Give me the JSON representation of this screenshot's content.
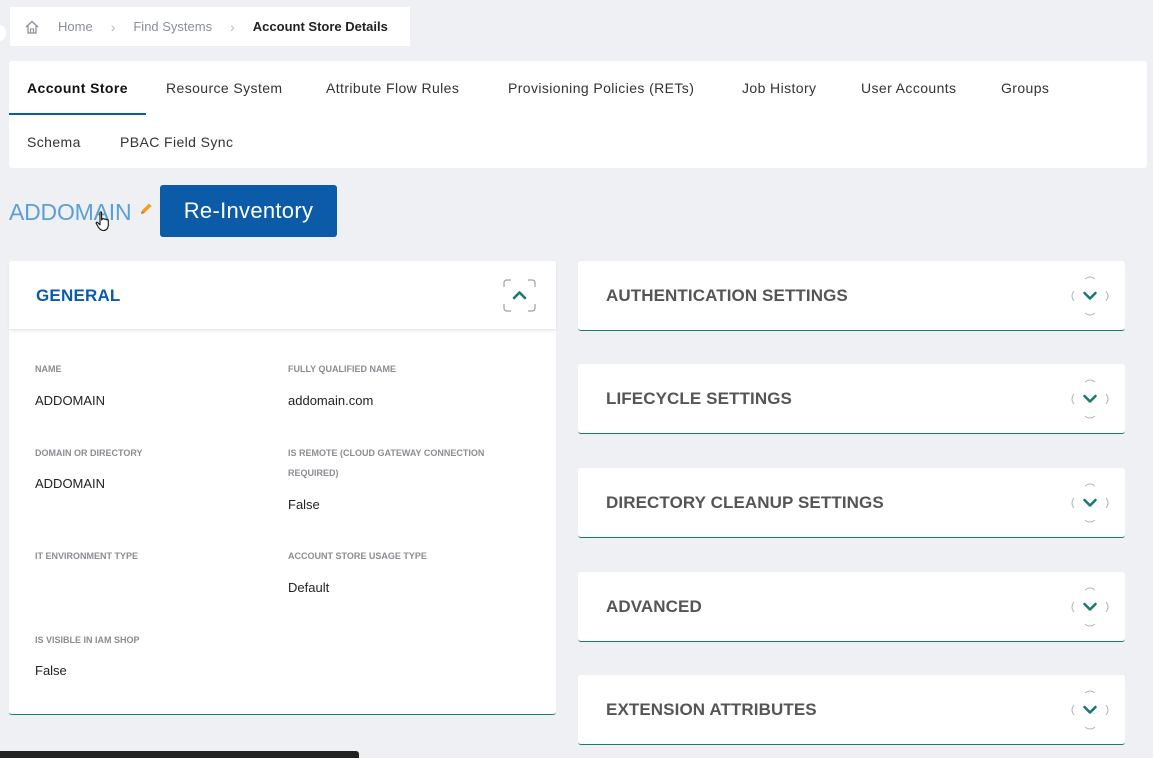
{
  "breadcrumb": {
    "home": "Home",
    "find_systems": "Find Systems",
    "current": "Account Store Details"
  },
  "tabs": [
    {
      "label": "Account Store",
      "active": true
    },
    {
      "label": "Resource System"
    },
    {
      "label": "Attribute Flow Rules"
    },
    {
      "label": "Provisioning Policies (RETs)"
    },
    {
      "label": "Job History"
    },
    {
      "label": "User Accounts"
    },
    {
      "label": "Groups"
    },
    {
      "label": "Schema"
    },
    {
      "label": "PBAC Field Sync"
    }
  ],
  "store_name": "ADDOMAIN",
  "reinventory_label": "Re-Inventory",
  "general": {
    "title": "GENERAL",
    "fields": {
      "name_label": "NAME",
      "name_value": "ADDOMAIN",
      "fqn_label": "FULLY QUALIFIED NAME",
      "fqn_value": "addomain.com",
      "domain_label": "DOMAIN OR DIRECTORY",
      "domain_value": "ADDOMAIN",
      "remote_label": "IS REMOTE (CLOUD GATEWAY CONNECTION REQUIRED)",
      "remote_value": "False",
      "env_label": "IT ENVIRONMENT TYPE",
      "env_value": "",
      "usage_label": "ACCOUNT STORE USAGE TYPE",
      "usage_value": "Default",
      "visible_label": "IS VISIBLE IN IAM SHOP",
      "visible_value": "False"
    }
  },
  "accordions": [
    {
      "title": "AUTHENTICATION SETTINGS"
    },
    {
      "title": "LIFECYCLE SETTINGS"
    },
    {
      "title": "DIRECTORY CLEANUP SETTINGS"
    },
    {
      "title": "ADVANCED"
    },
    {
      "title": "EXTENSION ATTRIBUTES"
    }
  ],
  "colors": {
    "primary": "#0b5ba8",
    "title_link": "#5c9fd8",
    "accent_teal": "#1a7a6d",
    "edit_orange": "#f0a020",
    "background": "#eef0f4"
  },
  "icons": {
    "home": "home-icon",
    "edit": "pencil-icon",
    "collapse": "chevron-up-icon",
    "expand": "chevron-down-icon"
  }
}
